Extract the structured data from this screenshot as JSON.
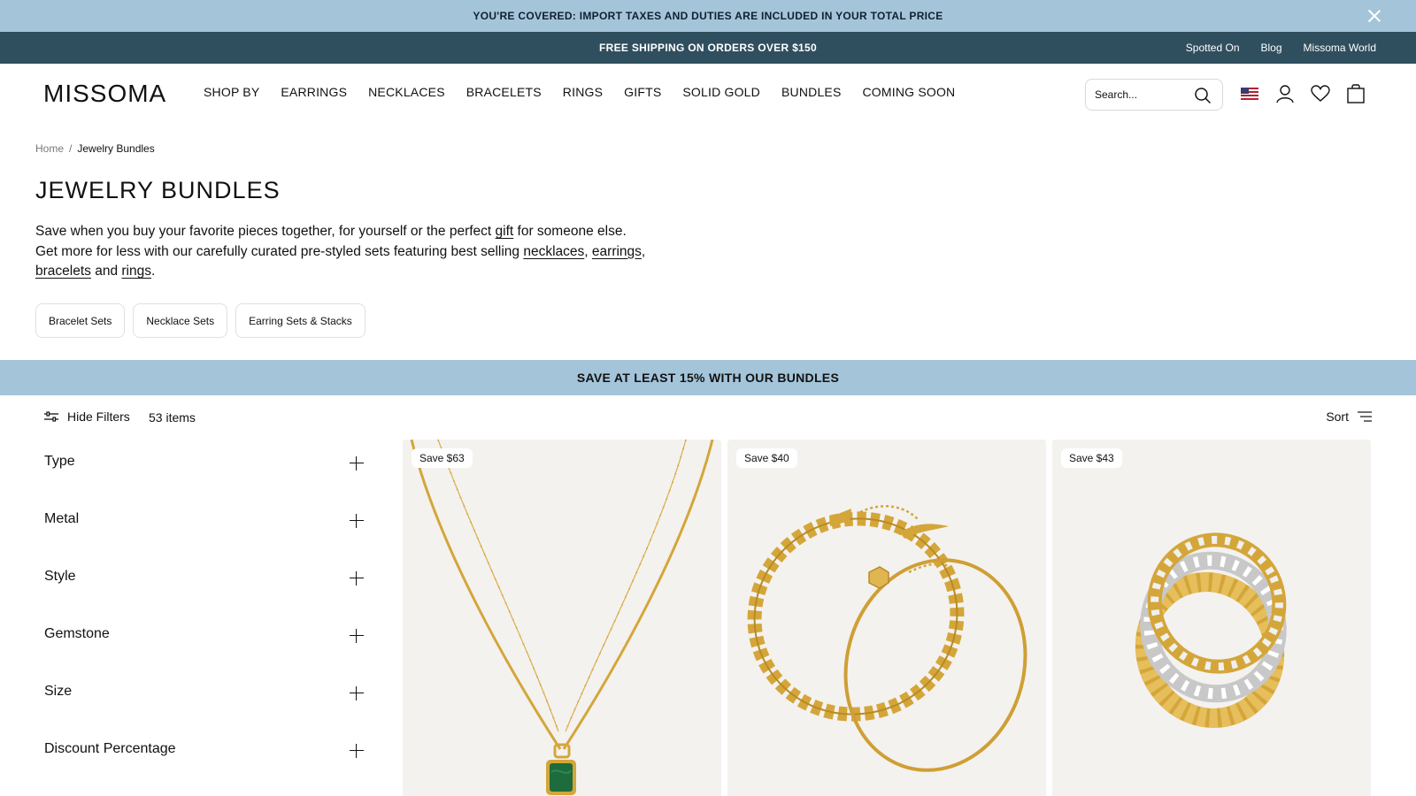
{
  "announcement": {
    "text": "YOU'RE COVERED: IMPORT TAXES AND DUTIES ARE INCLUDED IN YOUR TOTAL PRICE"
  },
  "utility": {
    "text": "FREE SHIPPING ON ORDERS OVER $150",
    "links": [
      "Spotted On",
      "Blog",
      "Missoma World"
    ]
  },
  "header": {
    "logo": "MISSOMA",
    "nav": [
      "SHOP BY",
      "EARRINGS",
      "NECKLACES",
      "BRACELETS",
      "RINGS",
      "GIFTS",
      "SOLID GOLD",
      "BUNDLES",
      "COMING SOON"
    ],
    "search_placeholder": "Search..."
  },
  "breadcrumb": {
    "home": "Home",
    "separator": "/",
    "current": "Jewelry Bundles"
  },
  "page": {
    "title": "JEWELRY BUNDLES",
    "desc": {
      "p1": "Save when you buy your favorite pieces together, for yourself or the perfect ",
      "gift": "gift",
      "p2": " for someone else. Get more for less with our carefully curated pre-styled sets featuring best selling ",
      "necklaces": "necklaces",
      "c1": ", ",
      "earrings": "earrings",
      "c2": ", ",
      "bracelets": "bracelets",
      "and": " and ",
      "rings": "rings",
      "end": "."
    },
    "chips": [
      "Bracelet Sets",
      "Necklace Sets",
      "Earring Sets & Stacks"
    ]
  },
  "promo": {
    "text": "SAVE AT LEAST 15% WITH OUR BUNDLES"
  },
  "toolbar": {
    "hide_filters": "Hide Filters",
    "count": "53 items",
    "sort": "Sort"
  },
  "filters": [
    "Type",
    "Metal",
    "Style",
    "Gemstone",
    "Size",
    "Discount Percentage"
  ],
  "products": [
    {
      "badge": "Save $63",
      "image": "gold-chain-necklaces-with-green-pendant"
    },
    {
      "badge": "Save $40",
      "image": "gold-chain-bracelets"
    },
    {
      "badge": "Save $43",
      "image": "gold-and-silver-stacked-rings"
    }
  ],
  "colors": {
    "announcement_bg": "#a4c4d9",
    "utility_bg": "#2f4f5f",
    "promo_bg": "#a4c4d9",
    "gold": "#d4a63a",
    "malachite": "#1e6b3c"
  }
}
